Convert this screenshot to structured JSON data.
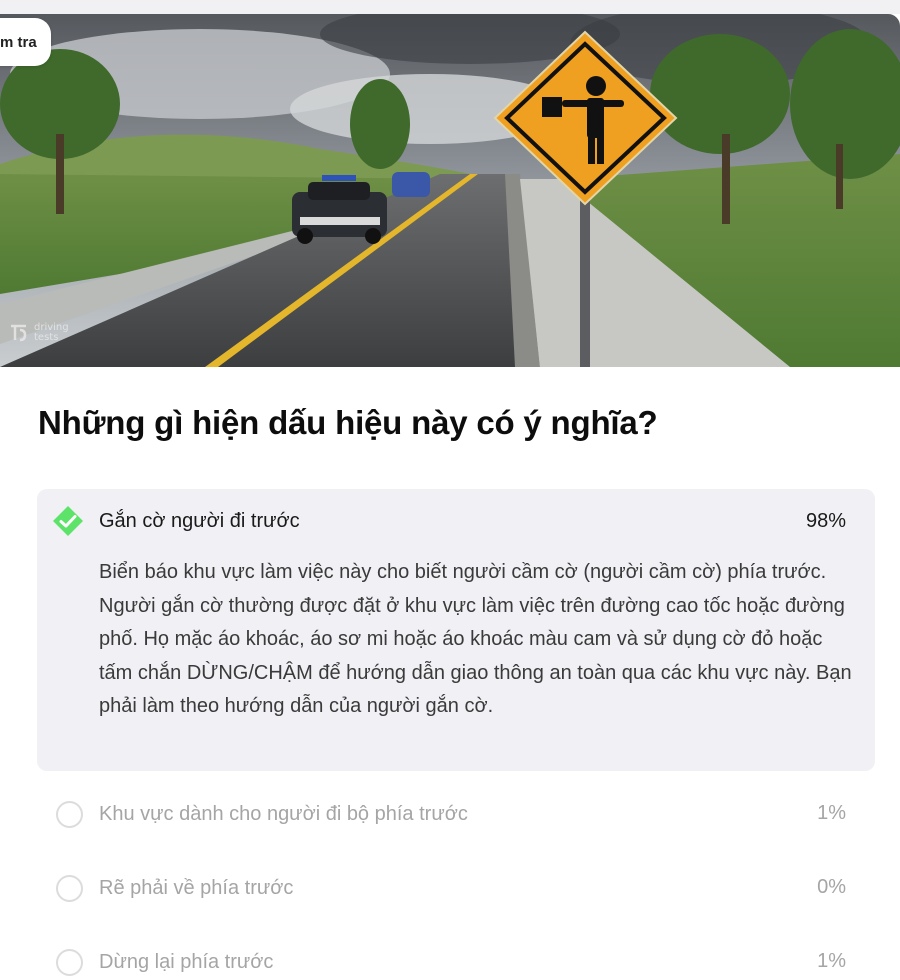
{
  "tab": {
    "label": "m tra"
  },
  "watermark": {
    "line1": "driving",
    "line2": "tests"
  },
  "question": {
    "text": "Những gì hiện dấu hiệu này có ý nghĩa?"
  },
  "answers": [
    {
      "label": "Gắn cờ người đi trước",
      "percent": "98%",
      "correct": true,
      "explanation": "Biển báo khu vực làm việc này cho biết người cầm cờ (người cầm cờ) phía trước. Người gắn cờ thường được đặt ở khu vực làm việc trên đường cao tốc hoặc đường phố. Họ mặc áo khoác, áo sơ mi hoặc áo khoác màu cam và sử dụng cờ đỏ hoặc tấm chắn DỪNG/CHẬM để hướng dẫn giao thông an toàn qua các khu vực này. Bạn phải làm theo hướng dẫn của người gắn cờ."
    },
    {
      "label": "Khu vực dành cho người đi bộ phía trước",
      "percent": "1%",
      "correct": false
    },
    {
      "label": "Rẽ phải về phía trước",
      "percent": "0%",
      "correct": false
    },
    {
      "label": "Dừng lại phía trước",
      "percent": "1%",
      "correct": false
    }
  ],
  "colors": {
    "correct": "#5ee36a",
    "selected_bg": "#f0f0f5",
    "sign": "#f0a020"
  },
  "icons": {
    "correct": "check-diamond-icon",
    "unselected": "radio-circle-icon",
    "logo": "driving-tests-logo-icon"
  }
}
